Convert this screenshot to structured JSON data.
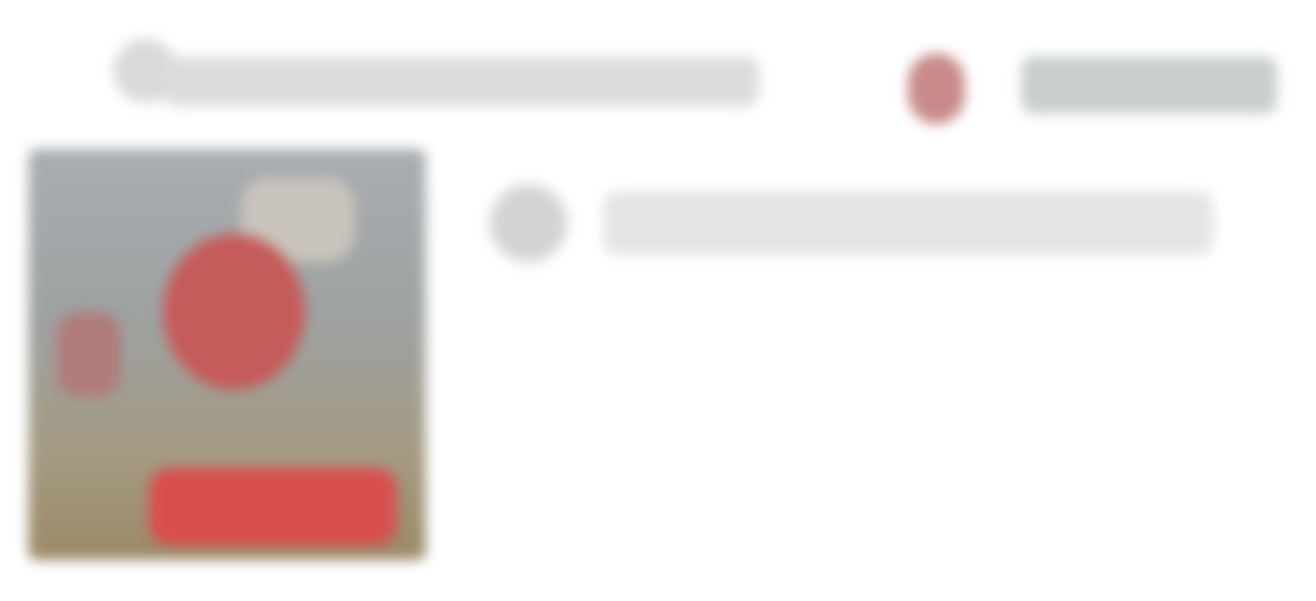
{
  "header": {
    "title": "",
    "action_label": ""
  },
  "media": {
    "banner_text": ""
  },
  "content": {
    "subheading": ""
  },
  "colors": {
    "accent": "#d94f4f",
    "button_bg": "#c9cdcd",
    "text_placeholder": "#dcdcdc"
  }
}
